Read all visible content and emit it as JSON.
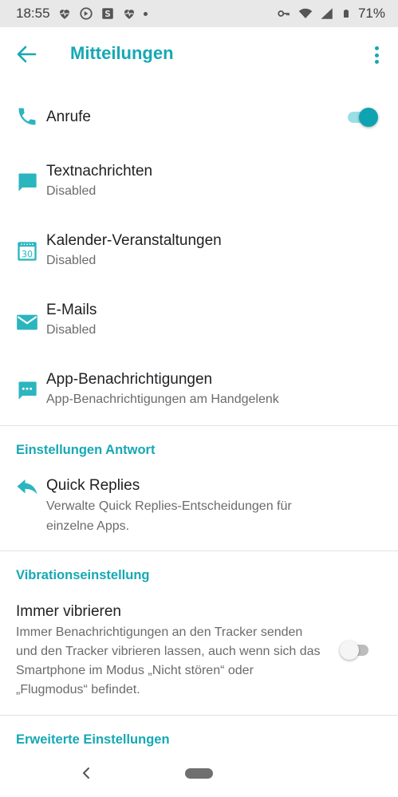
{
  "status_bar": {
    "time": "18:55",
    "battery": "71%"
  },
  "app_bar": {
    "title": "Mitteilungen"
  },
  "items": [
    {
      "title": "Anrufe",
      "subtitle": "",
      "icon": "phone-icon",
      "toggle": true
    },
    {
      "title": "Textnachrichten",
      "subtitle": "Disabled",
      "icon": "message-icon"
    },
    {
      "title": "Kalender-Veranstaltungen",
      "subtitle": "Disabled",
      "icon": "calendar-icon",
      "icon_text": "30"
    },
    {
      "title": "E-Mails",
      "subtitle": "Disabled",
      "icon": "mail-icon"
    },
    {
      "title": "App-Benachrichtigungen",
      "subtitle": "App-Benachrichtigungen am Handgelenk",
      "icon": "app-notification-icon"
    }
  ],
  "sections": {
    "reply": {
      "header": "Einstellungen Antwort",
      "quick_replies": {
        "title": "Quick Replies",
        "subtitle_line1": "Verwalte Quick Replies-Entscheidungen für",
        "subtitle_line2": "einzelne Apps."
      }
    },
    "vibration": {
      "header": "Vibrationseinstellung",
      "always_vibrate": {
        "title": "Immer vibrieren",
        "description": "Immer Benachrichtigungen an den Tracker senden und den Tracker vibrieren lassen, auch wenn sich das Smartphone im Modus „Nicht stören“ oder „Flugmodus“ befindet.",
        "toggle": false
      }
    },
    "advanced": {
      "header": "Erweiterte Einstellungen"
    }
  },
  "colors": {
    "accent": "#16a8b4",
    "toggle_on": "#0fa3b1",
    "text_primary": "#202124",
    "text_secondary": "#6b6b6b"
  }
}
